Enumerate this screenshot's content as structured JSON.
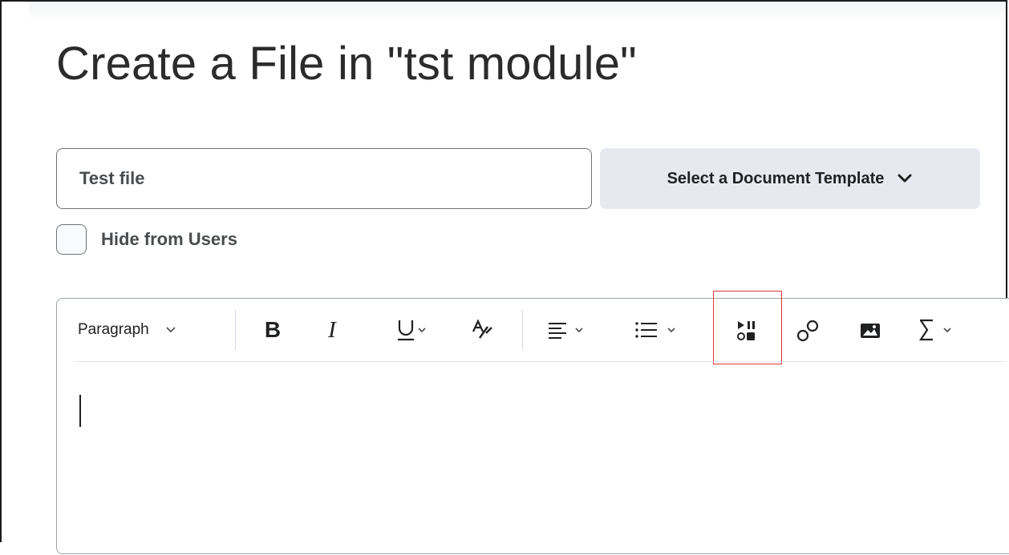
{
  "page": {
    "title": "Create a File in \"tst module\""
  },
  "form": {
    "name_value": "Test file",
    "template_button_label": "Select a Document Template",
    "hide_label": "Hide from Users",
    "hide_checked": false
  },
  "toolbar": {
    "format_label": "Paragraph",
    "buttons": [
      "bold-icon",
      "italic-icon",
      "underline-icon",
      "text-format-icon",
      "align-icon",
      "list-icon",
      "media-icon",
      "link-icon",
      "image-icon",
      "equation-icon"
    ]
  },
  "colors": {
    "button_bg": "#e6eaf0",
    "border": "#6e7376",
    "highlight": "#e03838"
  }
}
